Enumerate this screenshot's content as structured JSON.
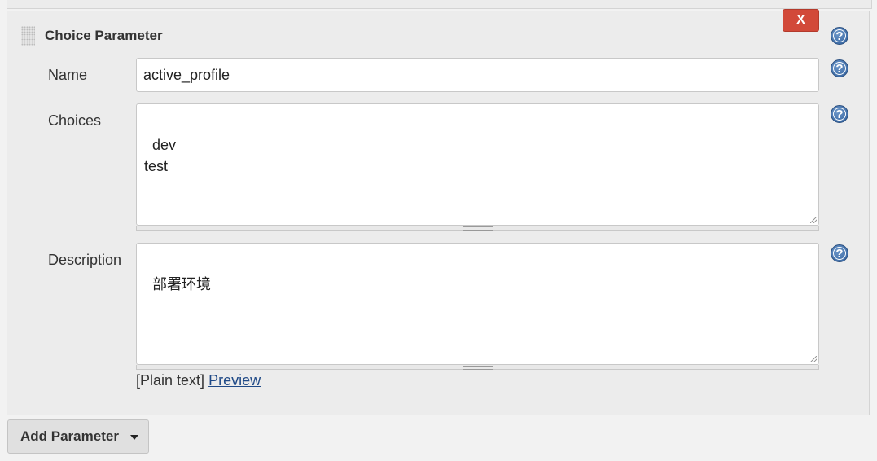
{
  "section": {
    "title": "Choice Parameter",
    "delete_label": "X"
  },
  "help": {
    "glyph": "?"
  },
  "fields": {
    "name": {
      "label": "Name",
      "value": "active_profile"
    },
    "choices": {
      "label": "Choices",
      "value": "dev\ntest"
    },
    "description": {
      "label": "Description",
      "value": "部署环境"
    }
  },
  "format": {
    "plain_text": "[Plain text]",
    "preview_link": "Preview"
  },
  "footer": {
    "add_parameter_label": "Add Parameter"
  },
  "colors": {
    "delete_button": "#d24939",
    "help_icon": "#2f5f9c",
    "link": "#204a87"
  }
}
